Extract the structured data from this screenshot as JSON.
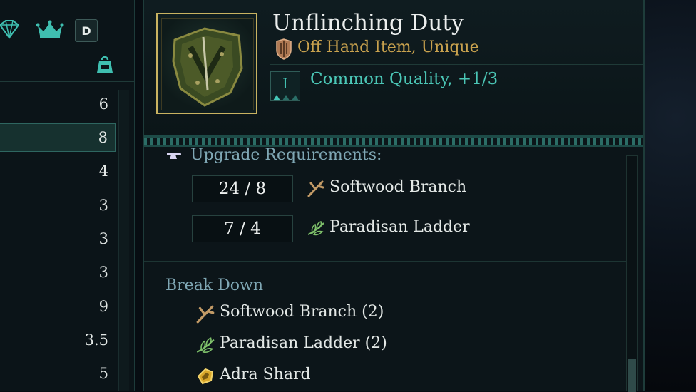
{
  "left_panel": {
    "header_icons": [
      "gem-icon",
      "crown-icon",
      "weight-icon"
    ],
    "d_badge": "D",
    "stats": [
      "6",
      "8",
      "4",
      "3",
      "3",
      "3",
      "9",
      "3.5",
      "5"
    ],
    "selected_index": 1
  },
  "item": {
    "title": "Unflinching Duty",
    "type": "Off Hand Item, Unique",
    "quality_tier": "I",
    "quality_text": "Common Quality, +1/3"
  },
  "upgrade": {
    "label": "Upgrade Requirements:",
    "requirements": [
      {
        "amount": "24 / 8",
        "name": "Softwood Branch",
        "icon": "branch-icon"
      },
      {
        "amount": "7 / 4",
        "name": "Paradisan Ladder",
        "icon": "leaf-icon"
      }
    ]
  },
  "breakdown": {
    "label": "Break Down",
    "items": [
      {
        "name": "Softwood Branch (2)",
        "icon": "branch-icon"
      },
      {
        "name": "Paradisan Ladder (2)",
        "icon": "leaf-icon"
      },
      {
        "name": "Adra Shard",
        "icon": "shard-icon"
      }
    ]
  },
  "colors": {
    "accent_teal": "#4bc6b6",
    "gold": "#c9a24e",
    "section_blue": "#7fa7b4"
  }
}
